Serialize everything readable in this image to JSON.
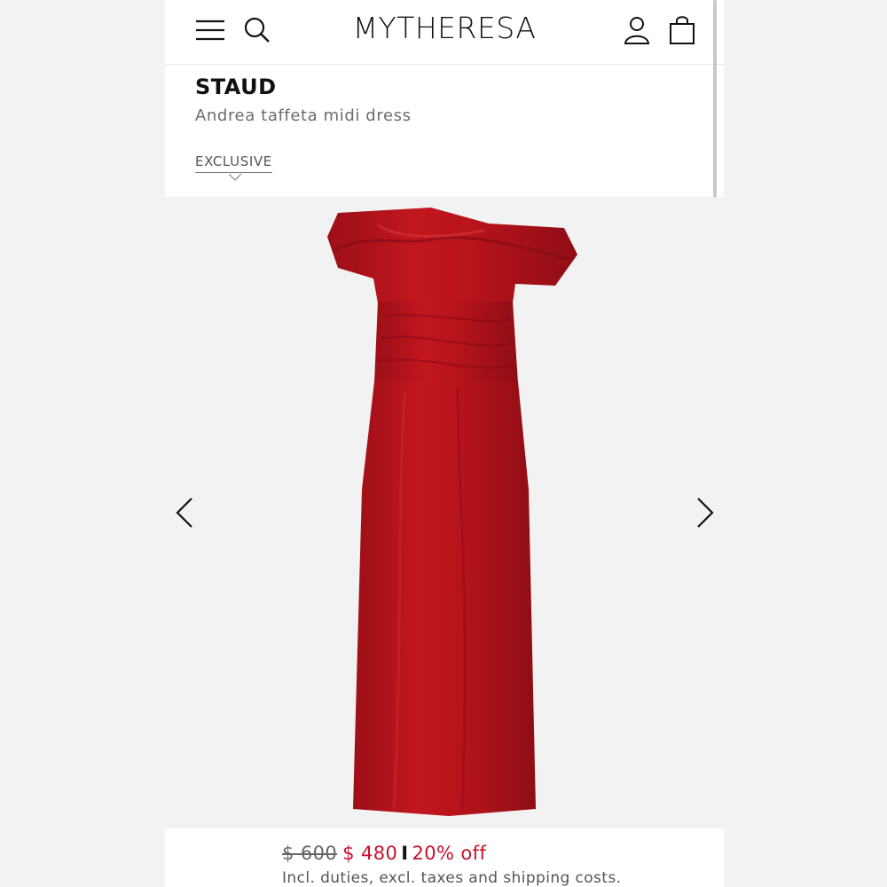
{
  "header": {
    "logo": "MYTHERESA",
    "icons": [
      "menu-icon",
      "search-icon",
      "account-icon",
      "shopping-bag-icon"
    ]
  },
  "product": {
    "brand": "STAUD",
    "name": "Andrea taffeta midi dress",
    "badge": "EXCLUSIVE",
    "image_subject": "red strapless taffeta midi dress",
    "dress_color": "#b8141c"
  },
  "pricing": {
    "original": "$ 600",
    "sale": "$ 480",
    "separator": "I",
    "discount": "20% off",
    "note": "Incl. duties, excl. taxes and shipping costs."
  },
  "colors": {
    "accent": "#c8102e",
    "text": "#111111",
    "muted": "#6b6b6b",
    "background": "#f2f2f2"
  }
}
